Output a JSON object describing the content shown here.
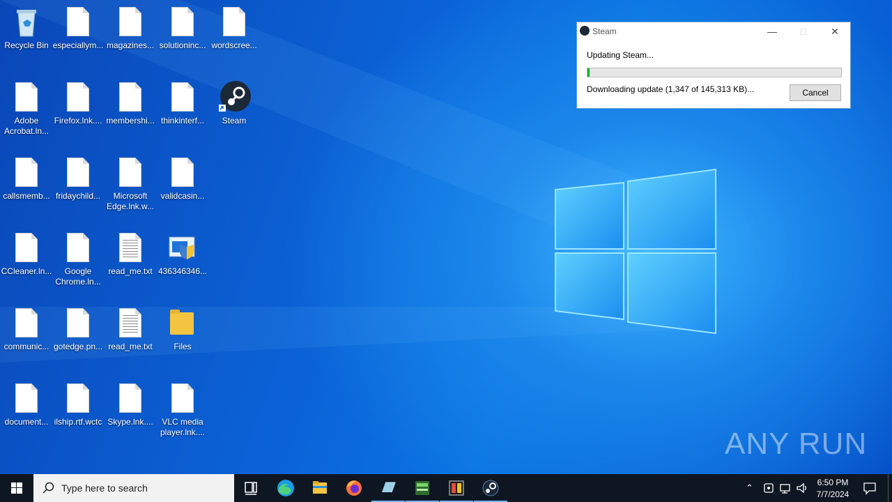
{
  "desktop": {
    "icons": [
      {
        "label": "Recycle Bin",
        "icon": "recycle-bin-icon"
      },
      {
        "label": "especiallym...",
        "icon": "file-icon"
      },
      {
        "label": "magazines...",
        "icon": "file-icon"
      },
      {
        "label": "solutioninc...",
        "icon": "file-icon"
      },
      {
        "label": "wordscree...",
        "icon": "file-icon"
      },
      {
        "label": "Adobe Acrobat.ln...",
        "icon": "file-icon"
      },
      {
        "label": "Firefox.lnk....",
        "icon": "file-icon"
      },
      {
        "label": "membershi...",
        "icon": "file-icon"
      },
      {
        "label": "thinkinterf...",
        "icon": "file-icon"
      },
      {
        "label": "Steam",
        "icon": "steam-icon"
      },
      {
        "label": "callsmemb...",
        "icon": "file-icon"
      },
      {
        "label": "fridaychild...",
        "icon": "file-icon"
      },
      {
        "label": "Microsoft Edge.lnk.w...",
        "icon": "file-icon"
      },
      {
        "label": "validcasin...",
        "icon": "file-icon"
      },
      {
        "label": "CCleaner.ln...",
        "icon": "file-icon"
      },
      {
        "label": "Google Chrome.ln...",
        "icon": "file-icon"
      },
      {
        "label": "read_me.txt",
        "icon": "text-file-icon"
      },
      {
        "label": "436346346...",
        "icon": "installer-icon"
      },
      {
        "label": "communic...",
        "icon": "file-icon"
      },
      {
        "label": "gotedge.pn...",
        "icon": "file-icon"
      },
      {
        "label": "read_me.txt",
        "icon": "text-file-icon"
      },
      {
        "label": "Files",
        "icon": "folder-icon"
      },
      {
        "label": "document...",
        "icon": "file-icon"
      },
      {
        "label": "ilship.rtf.wctc",
        "icon": "file-icon"
      },
      {
        "label": "Skype.lnk....",
        "icon": "file-icon"
      },
      {
        "label": "VLC media player.lnk....",
        "icon": "file-icon"
      }
    ]
  },
  "dialog": {
    "title": "Steam",
    "status": "Updating Steam...",
    "progress": 0.009,
    "detail": "Downloading update (1,347 of 145,313 KB)...",
    "cancel_label": "Cancel"
  },
  "watermark": "ANY RUN",
  "taskbar": {
    "search_placeholder": "Type here to search",
    "apps": [
      "task-view",
      "edge",
      "file-explorer",
      "firefox",
      "app-5",
      "app-6",
      "app-7",
      "steam"
    ],
    "time": "6:50 PM",
    "date": "7/7/2024"
  },
  "colors": {
    "accent": "#0078d7",
    "taskbar": "#0e1621",
    "progress": "#06b025"
  }
}
